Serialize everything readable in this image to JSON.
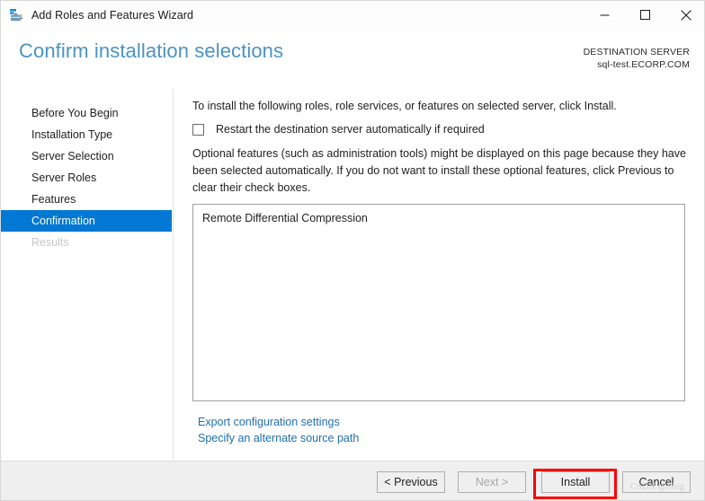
{
  "window": {
    "title": "Add Roles and Features Wizard",
    "icon": "server-manager-icon",
    "minimize_label": "minimize-icon",
    "maximize_label": "maximize-icon",
    "close_label": "close-icon"
  },
  "header": {
    "page_title": "Confirm installation selections",
    "destination_label": "DESTINATION SERVER",
    "destination_value": "sql-test.ECORP.COM"
  },
  "sidebar": {
    "items": [
      {
        "label": "Before You Begin",
        "state": "normal"
      },
      {
        "label": "Installation Type",
        "state": "normal"
      },
      {
        "label": "Server Selection",
        "state": "normal"
      },
      {
        "label": "Server Roles",
        "state": "normal"
      },
      {
        "label": "Features",
        "state": "normal"
      },
      {
        "label": "Confirmation",
        "state": "selected"
      },
      {
        "label": "Results",
        "state": "disabled"
      }
    ]
  },
  "main": {
    "intro": "To install the following roles, role services, or features on selected server, click Install.",
    "restart_checkbox_label": "Restart the destination server automatically if required",
    "restart_checkbox_checked": false,
    "optional_note": "Optional features (such as administration tools) might be displayed on this page because they have been selected automatically. If you do not want to install these optional features, click Previous to clear their check boxes.",
    "selected_features": [
      "Remote Differential Compression"
    ],
    "links": [
      "Export configuration settings",
      "Specify an alternate source path"
    ]
  },
  "footer": {
    "previous_label": "< Previous",
    "next_label": "Next >",
    "install_label": "Install",
    "cancel_label": "Cancel",
    "next_disabled": true,
    "highlighted_button": "Install",
    "highlight_color": "#ff0000"
  },
  "overlay": {
    "watermark": "CSDN @blog"
  },
  "colors": {
    "accent_blue": "#0078d4",
    "title_blue": "#4a93c4",
    "link_blue": "#1f6fb0",
    "footer_bg": "#efefef",
    "annotation_red": "#ff0000"
  }
}
